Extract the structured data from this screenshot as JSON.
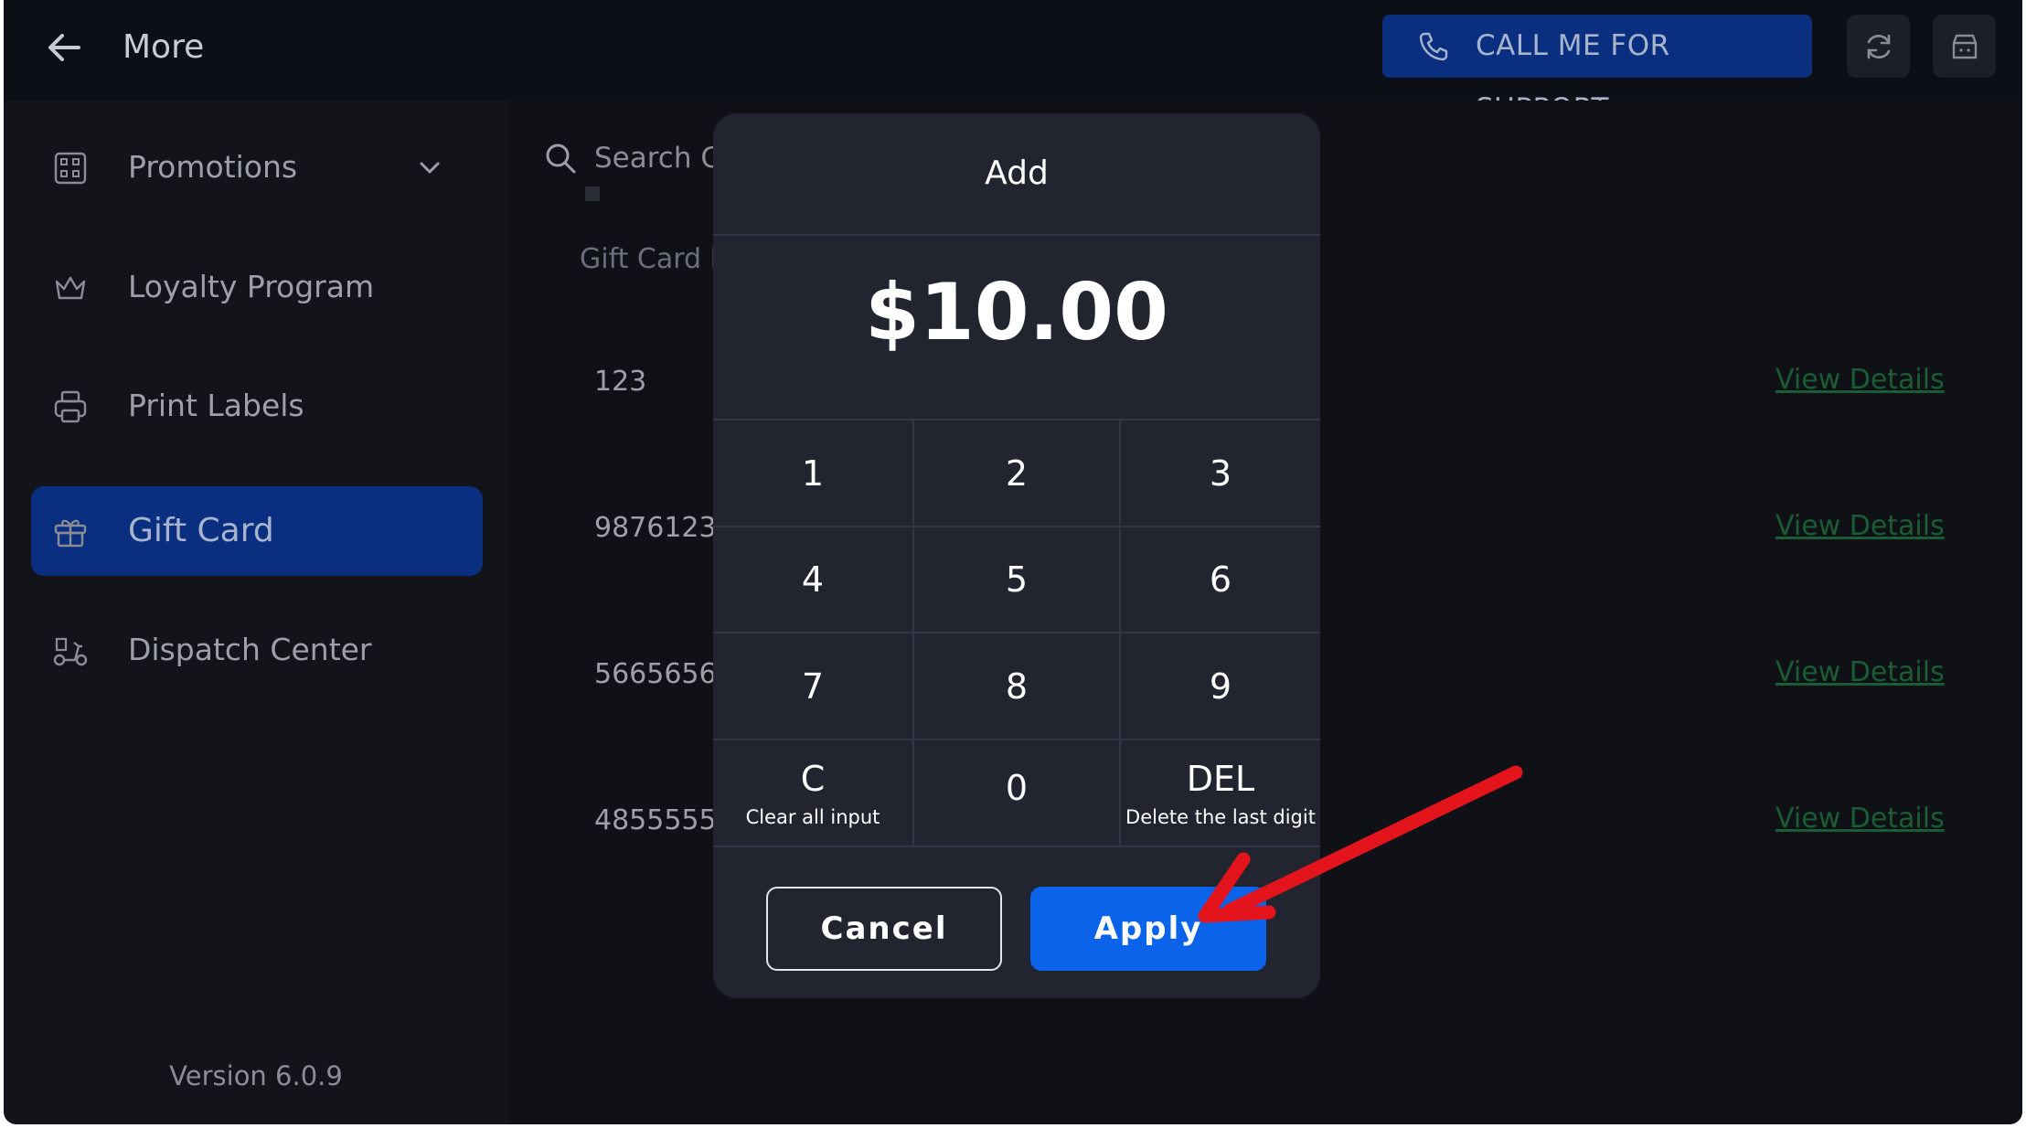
{
  "header": {
    "title": "More",
    "support_label": "CALL ME FOR SUPPORT"
  },
  "sidebar": {
    "items": [
      {
        "label": "Promotions",
        "icon": "promotions-icon"
      },
      {
        "label": "Loyalty Program",
        "icon": "crown-icon"
      },
      {
        "label": "Print Labels",
        "icon": "printer-icon"
      },
      {
        "label": "Gift Card",
        "icon": "gift-icon",
        "active": true
      },
      {
        "label": "Dispatch Center",
        "icon": "scooter-icon"
      }
    ],
    "version": "Version 6.0.9"
  },
  "main": {
    "search_placeholder": "Search C",
    "column_header": "Gift Card N",
    "rows": [
      {
        "number": "123",
        "link": "View Details"
      },
      {
        "number": "9876123",
        "link": "View Details"
      },
      {
        "number": "5665656",
        "link": "View Details"
      },
      {
        "number": "4855555",
        "link": "View Details"
      }
    ]
  },
  "modal": {
    "title": "Add",
    "amount": "$10.00",
    "keys": [
      {
        "value": "1",
        "sub": ""
      },
      {
        "value": "2",
        "sub": ""
      },
      {
        "value": "3",
        "sub": ""
      },
      {
        "value": "4",
        "sub": ""
      },
      {
        "value": "5",
        "sub": ""
      },
      {
        "value": "6",
        "sub": ""
      },
      {
        "value": "7",
        "sub": ""
      },
      {
        "value": "8",
        "sub": ""
      },
      {
        "value": "9",
        "sub": ""
      },
      {
        "value": "C",
        "sub": "Clear all input"
      },
      {
        "value": "0",
        "sub": ""
      },
      {
        "value": "DEL",
        "sub": "Delete the last digit"
      }
    ],
    "cancel_label": "Cancel",
    "apply_label": "Apply"
  },
  "colors": {
    "accent": "#0b63ea",
    "nav_active": "#0b2f80",
    "annotation_arrow": "#e3141b",
    "link": "#1a5c33"
  }
}
